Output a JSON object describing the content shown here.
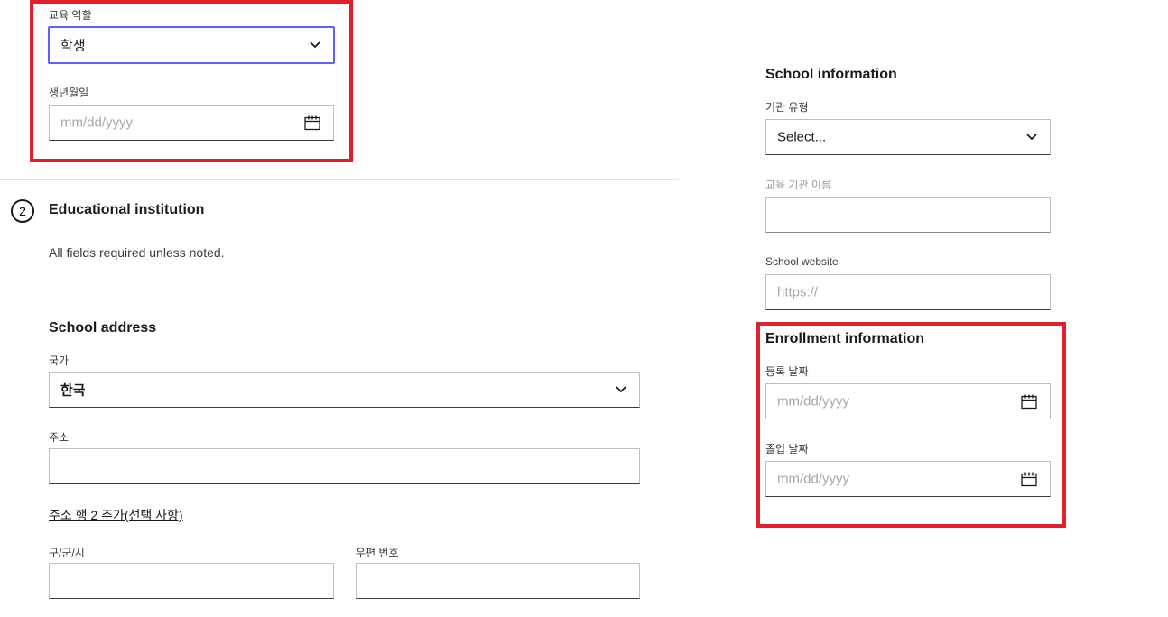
{
  "personal": {
    "role_label": "교육 역할",
    "role_value": "학생",
    "dob_label": "생년월일",
    "dob_placeholder": "mm/dd/yyyy"
  },
  "section2": {
    "step_number": "2",
    "title": "Educational institution",
    "note": "All fields required unless noted."
  },
  "address": {
    "heading": "School address",
    "country_label": "국가",
    "country_value": "한국",
    "address_label": "주소",
    "add_line_link": "주소 행 2 추가(선택 사항)",
    "city_label": "구/군/시",
    "postal_label": "우편 번호"
  },
  "school_info": {
    "heading": "School information",
    "type_label": "기관 유형",
    "type_value": "Select...",
    "name_label": "교육 기관 이름",
    "website_label": "School website",
    "website_placeholder": "https://"
  },
  "enrollment": {
    "heading": "Enrollment information",
    "enroll_label": "등록 날짜",
    "enroll_placeholder": "mm/dd/yyyy",
    "grad_label": "졸업 날짜",
    "grad_placeholder": "mm/dd/yyyy"
  },
  "colors": {
    "highlight": "#e0202a",
    "focus": "#5f60ff",
    "text": "#1a1a1a"
  },
  "icons": {
    "dropdown": "chevron-down-icon",
    "date": "calendar-icon"
  }
}
